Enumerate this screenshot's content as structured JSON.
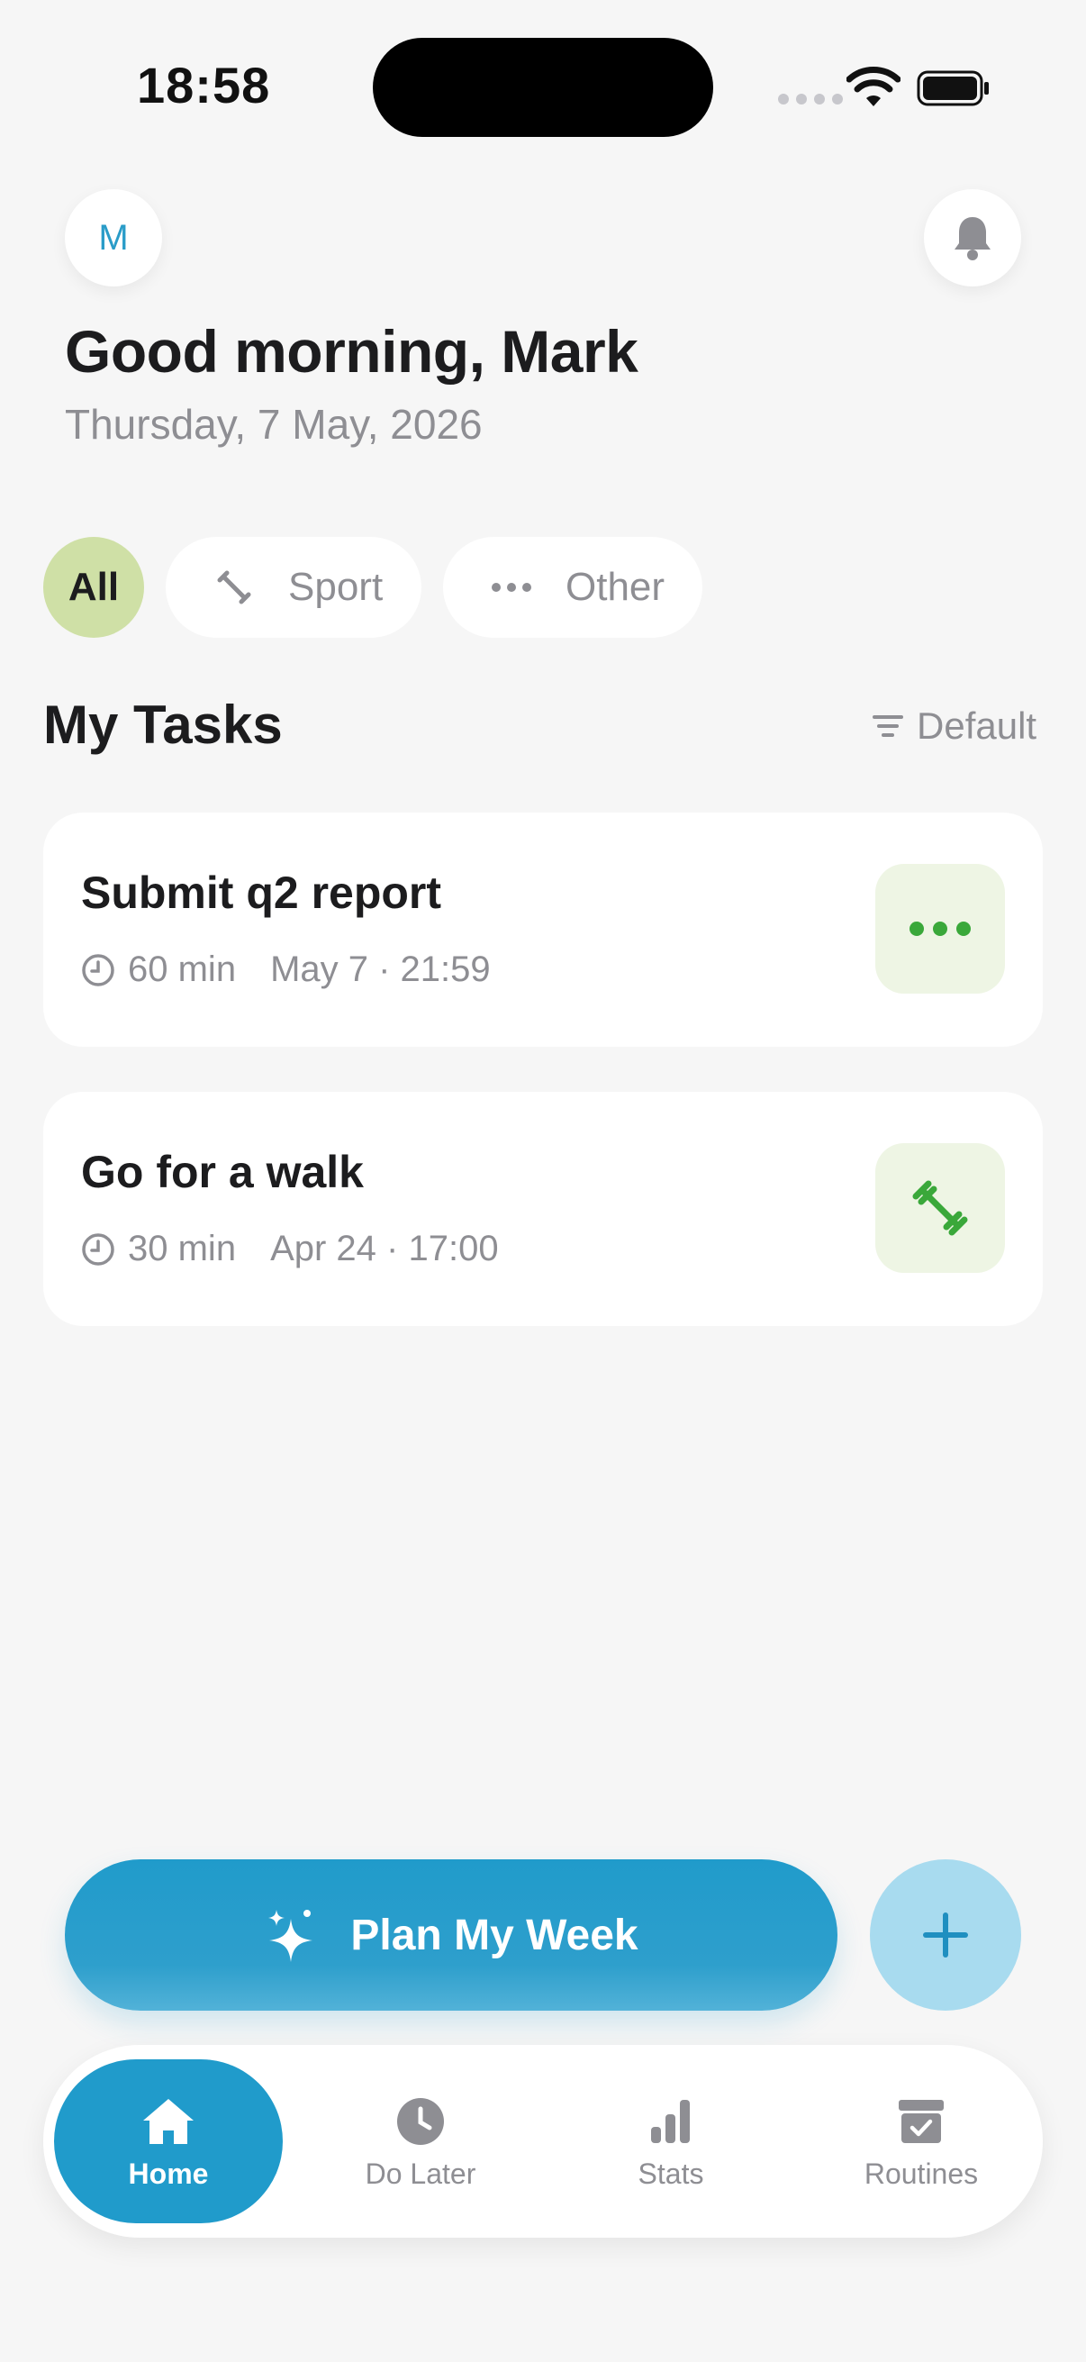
{
  "status_bar": {
    "time": "18:58"
  },
  "header": {
    "avatar_initial": "M",
    "greeting": "Good morning, Mark",
    "date": "Thursday, 7 May, 2026"
  },
  "filters": {
    "all": "All",
    "sport": "Sport",
    "other": "Other"
  },
  "tasks_section": {
    "title": "My Tasks",
    "sort_label": "Default"
  },
  "tasks": [
    {
      "title": "Submit q2 report",
      "duration": "60 min",
      "due": "May 7 · 21:59",
      "category_icon": "more-dots-icon"
    },
    {
      "title": "Go for a walk",
      "duration": "30 min",
      "due": "Apr 24 · 17:00",
      "category_icon": "dumbbell-icon"
    }
  ],
  "actions": {
    "plan_label": "Plan My Week"
  },
  "tabbar": {
    "home": "Home",
    "do_later": "Do Later",
    "stats": "Stats",
    "routines": "Routines"
  },
  "colors": {
    "accent": "#209bcb",
    "chip_selected": "#cfe0a6",
    "category_green": "#3aa83a",
    "category_bg": "#eef5e4"
  }
}
